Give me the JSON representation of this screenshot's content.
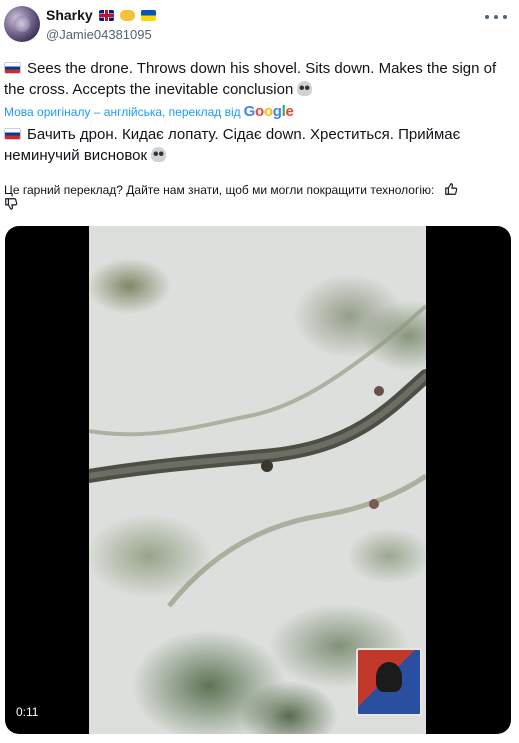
{
  "author": {
    "display_name": "Sharky",
    "handle": "@Jamie04381095",
    "badges": [
      "flag-uk",
      "handshake",
      "flag-ua"
    ]
  },
  "post": {
    "original_text": "Sees the drone. Throws down his shovel. Sits down. Makes the sign of the cross. Accepts the inevitable conclusion",
    "translated_by": "Мова оригіналу – англійська, переклад від",
    "translator_logo": [
      "G",
      "o",
      "o",
      "g",
      "l",
      "e"
    ],
    "translated_text": "Бачить дрон. Кидає лопату. Сідає down. Хреститься. Приймає неминучий висновок",
    "feedback_prompt": "Це гарний переклад? Дайте нам знати, щоб ми могли покращити технологію:"
  },
  "media": {
    "timestamp": "0:11",
    "icons": [
      "thumb-up-icon",
      "thumb-down-icon",
      "more-icon",
      "skull-icon",
      "russia-flag-icon"
    ]
  }
}
